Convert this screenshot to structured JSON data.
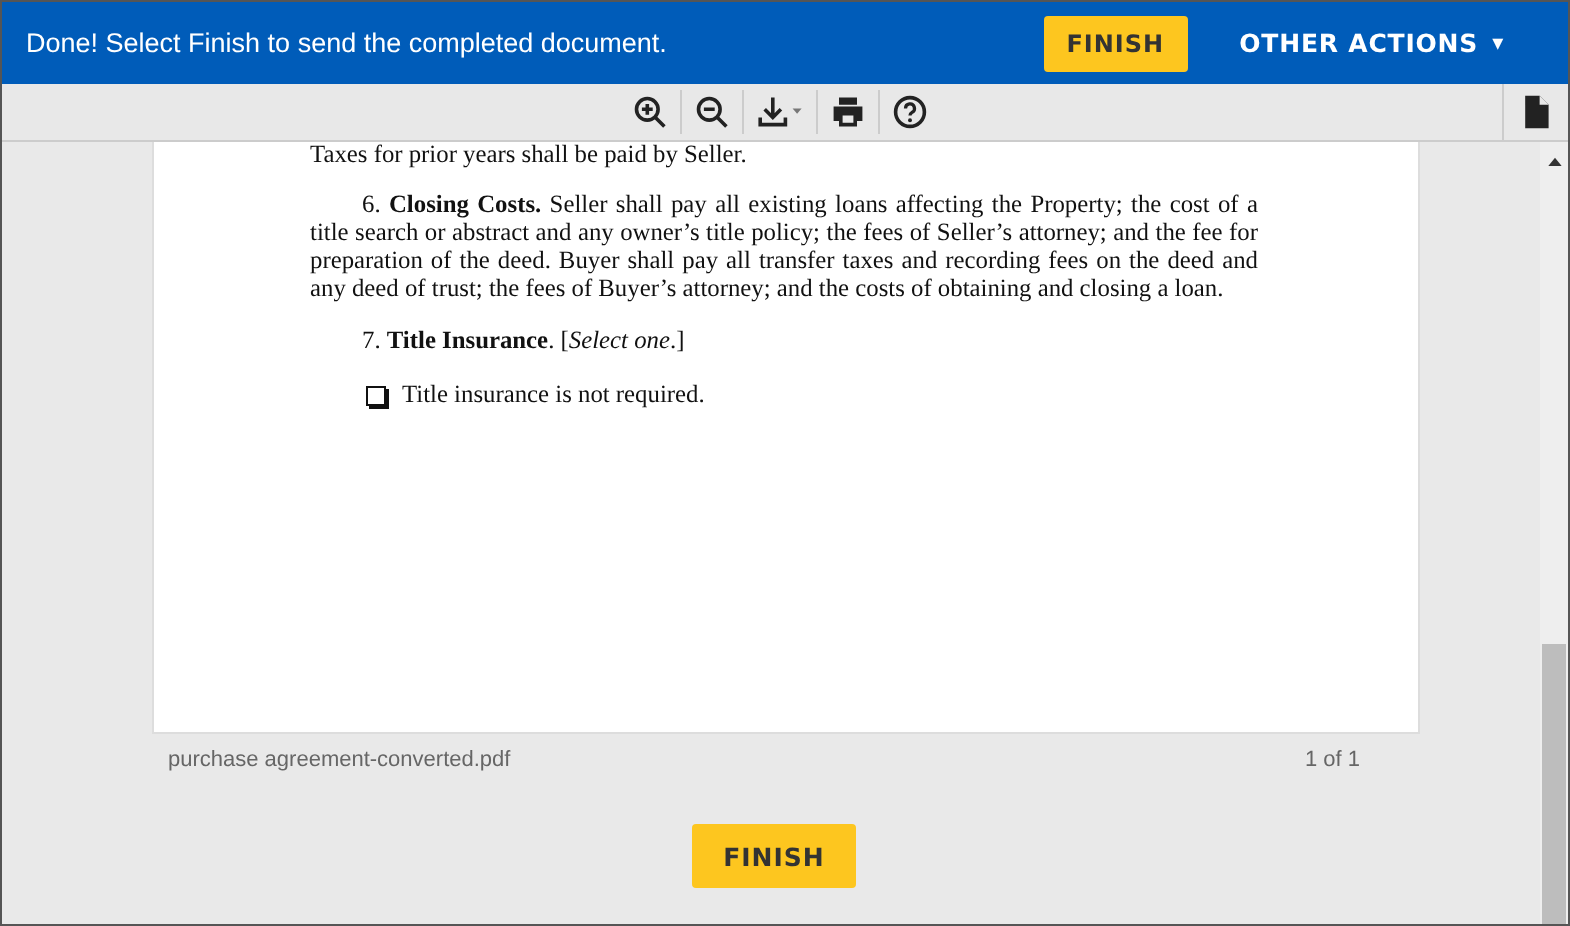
{
  "banner": {
    "message": "Done! Select Finish to send the completed document.",
    "finish_label": "FINISH",
    "actions_label": "OTHER ACTIONS",
    "actions_caret": "▾"
  },
  "document": {
    "lead_line": "Taxes for prior years shall be paid by Seller.",
    "paragraphs": [
      {
        "kind": "paragraph",
        "text": "6.  **Closing Costs.** Seller shall pay all existing loans affecting the Property; the cost of a title search or abstract and any owner’s title policy; the fees of Seller’s attorney; and the fee for preparation of the deed. Buyer shall pay all transfer taxes and recording fees on the deed and any deed of trust; the fees of Buyer’s attorney; and the costs of obtaining and closing a loan."
      },
      {
        "kind": "heading",
        "text": "7. **Title Insurance**. [*Select one*.]"
      },
      {
        "kind": "checkbox",
        "text": "Title insurance is not required.",
        "checked": false
      }
    ],
    "filename": "purchase agreement-converted.pdf",
    "page_count": "1 of 1"
  },
  "footer": {
    "finish_label": "FINISH"
  }
}
